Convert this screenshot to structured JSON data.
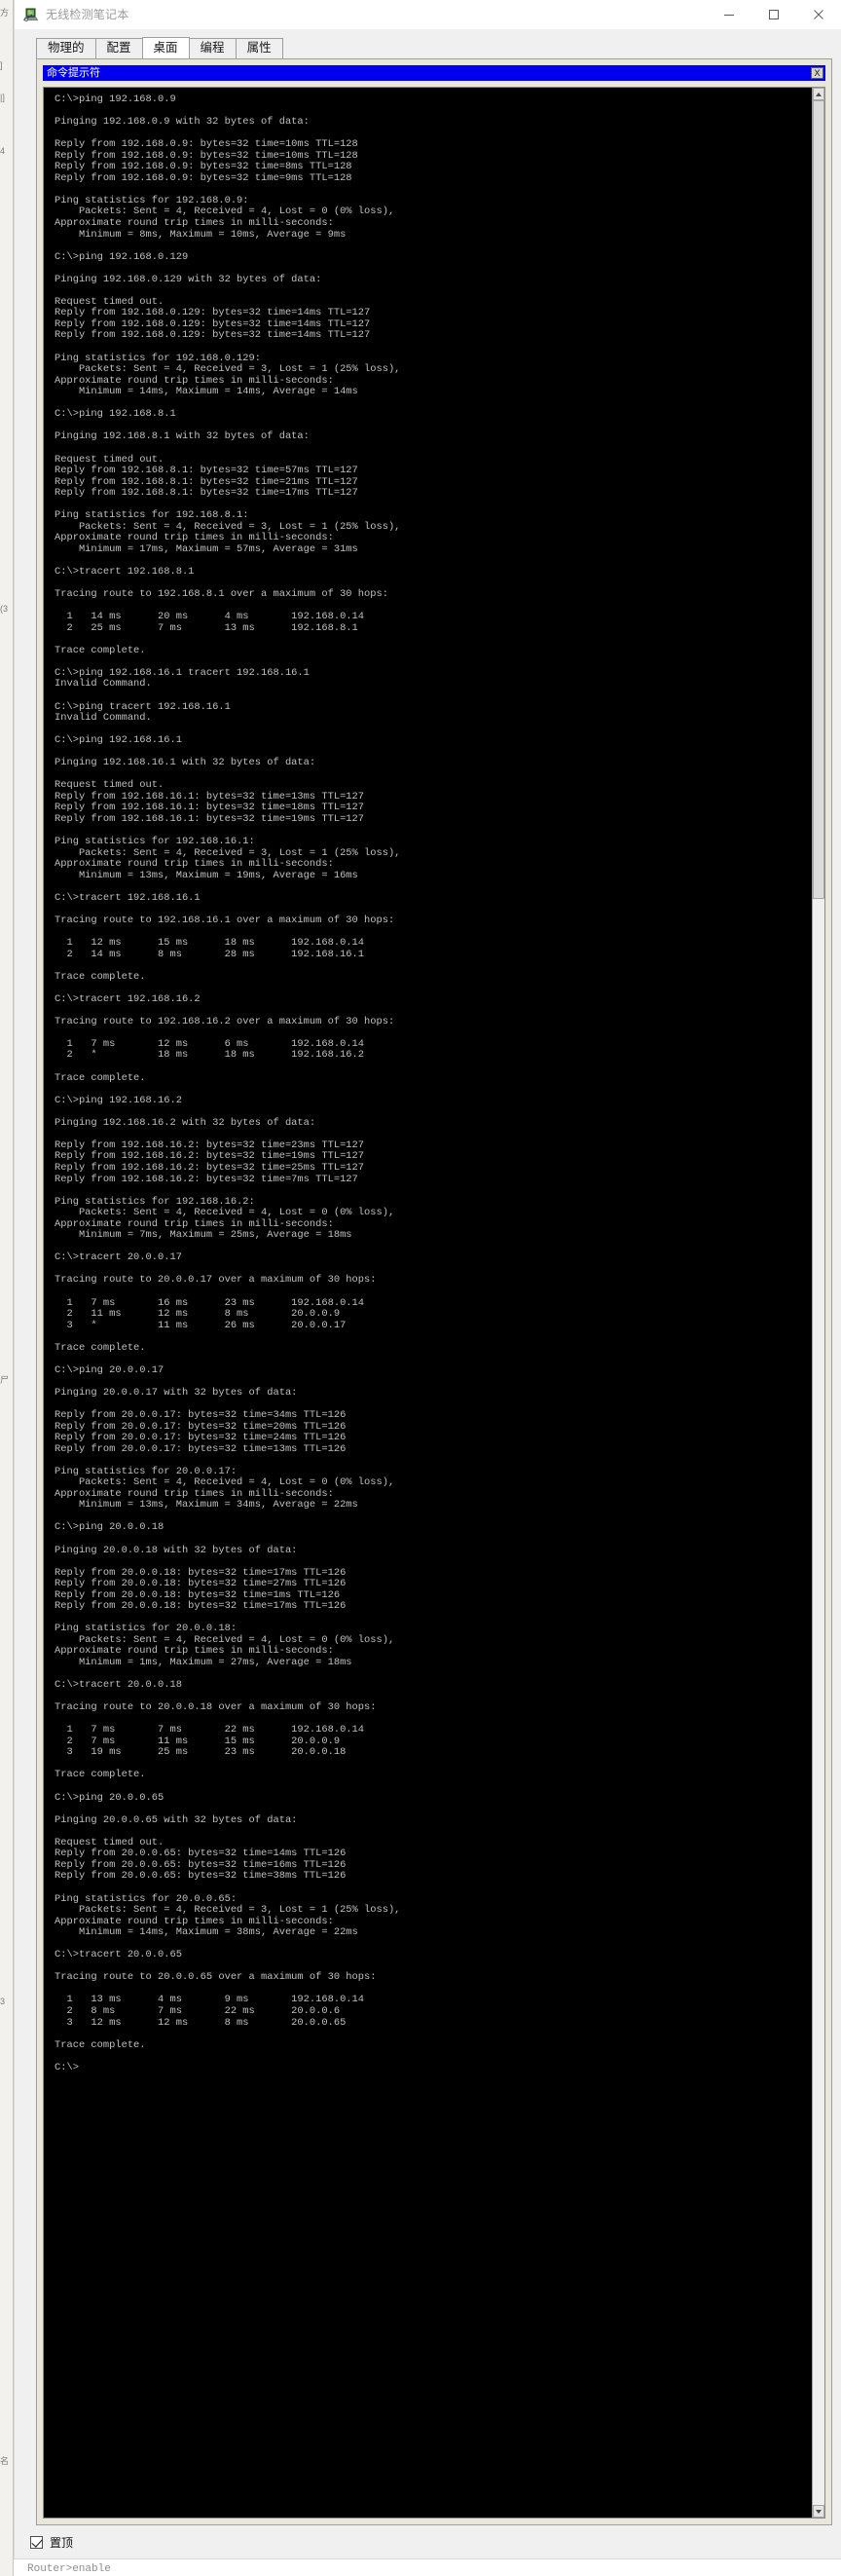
{
  "window": {
    "title": "无线检测笔记本",
    "icon": "laptop-wireless-icon",
    "controls": {
      "minimize": "minimize-icon",
      "maximize": "maximize-icon",
      "close": "close-icon"
    }
  },
  "tabs": [
    {
      "label": "物理的",
      "active": false
    },
    {
      "label": "配置",
      "active": false
    },
    {
      "label": "桌面",
      "active": true
    },
    {
      "label": "编程",
      "active": false
    },
    {
      "label": "属性",
      "active": false
    }
  ],
  "app": {
    "title": "命令提示符",
    "close_label": "X",
    "title_bar_color": "#0000ee",
    "terminal_bg": "#000000",
    "terminal_fg": "#c0c0c0"
  },
  "footer": {
    "always_on_top_label": "置顶",
    "always_on_top_checked": true
  },
  "background": {
    "left_fragments": [
      "方",
      "]",
      "|]",
      "4",
      "(3",
      "尸",
      "3",
      "名"
    ],
    "bottom_text": "Router>enable"
  },
  "terminal": {
    "text": "C:\\>ping 192.168.0.9\n\nPinging 192.168.0.9 with 32 bytes of data:\n\nReply from 192.168.0.9: bytes=32 time=10ms TTL=128\nReply from 192.168.0.9: bytes=32 time=10ms TTL=128\nReply from 192.168.0.9: bytes=32 time=8ms TTL=128\nReply from 192.168.0.9: bytes=32 time=9ms TTL=128\n\nPing statistics for 192.168.0.9:\n    Packets: Sent = 4, Received = 4, Lost = 0 (0% loss),\nApproximate round trip times in milli-seconds:\n    Minimum = 8ms, Maximum = 10ms, Average = 9ms\n\nC:\\>ping 192.168.0.129\n\nPinging 192.168.0.129 with 32 bytes of data:\n\nRequest timed out.\nReply from 192.168.0.129: bytes=32 time=14ms TTL=127\nReply from 192.168.0.129: bytes=32 time=14ms TTL=127\nReply from 192.168.0.129: bytes=32 time=14ms TTL=127\n\nPing statistics for 192.168.0.129:\n    Packets: Sent = 4, Received = 3, Lost = 1 (25% loss),\nApproximate round trip times in milli-seconds:\n    Minimum = 14ms, Maximum = 14ms, Average = 14ms\n\nC:\\>ping 192.168.8.1\n\nPinging 192.168.8.1 with 32 bytes of data:\n\nRequest timed out.\nReply from 192.168.8.1: bytes=32 time=57ms TTL=127\nReply from 192.168.8.1: bytes=32 time=21ms TTL=127\nReply from 192.168.8.1: bytes=32 time=17ms TTL=127\n\nPing statistics for 192.168.8.1:\n    Packets: Sent = 4, Received = 3, Lost = 1 (25% loss),\nApproximate round trip times in milli-seconds:\n    Minimum = 17ms, Maximum = 57ms, Average = 31ms\n\nC:\\>tracert 192.168.8.1\n\nTracing route to 192.168.8.1 over a maximum of 30 hops:\n\n  1   14 ms      20 ms      4 ms       192.168.0.14\n  2   25 ms      7 ms       13 ms      192.168.8.1\n\nTrace complete.\n\nC:\\>ping 192.168.16.1 tracert 192.168.16.1\nInvalid Command.\n\nC:\\>ping tracert 192.168.16.1\nInvalid Command.\n\nC:\\>ping 192.168.16.1\n\nPinging 192.168.16.1 with 32 bytes of data:\n\nRequest timed out.\nReply from 192.168.16.1: bytes=32 time=13ms TTL=127\nReply from 192.168.16.1: bytes=32 time=18ms TTL=127\nReply from 192.168.16.1: bytes=32 time=19ms TTL=127\n\nPing statistics for 192.168.16.1:\n    Packets: Sent = 4, Received = 3, Lost = 1 (25% loss),\nApproximate round trip times in milli-seconds:\n    Minimum = 13ms, Maximum = 19ms, Average = 16ms\n\nC:\\>tracert 192.168.16.1\n\nTracing route to 192.168.16.1 over a maximum of 30 hops:\n\n  1   12 ms      15 ms      18 ms      192.168.0.14\n  2   14 ms      8 ms       28 ms      192.168.16.1\n\nTrace complete.\n\nC:\\>tracert 192.168.16.2\n\nTracing route to 192.168.16.2 over a maximum of 30 hops:\n\n  1   7 ms       12 ms      6 ms       192.168.0.14\n  2   *          18 ms      18 ms      192.168.16.2\n\nTrace complete.\n\nC:\\>ping 192.168.16.2\n\nPinging 192.168.16.2 with 32 bytes of data:\n\nReply from 192.168.16.2: bytes=32 time=23ms TTL=127\nReply from 192.168.16.2: bytes=32 time=19ms TTL=127\nReply from 192.168.16.2: bytes=32 time=25ms TTL=127\nReply from 192.168.16.2: bytes=32 time=7ms TTL=127\n\nPing statistics for 192.168.16.2:\n    Packets: Sent = 4, Received = 4, Lost = 0 (0% loss),\nApproximate round trip times in milli-seconds:\n    Minimum = 7ms, Maximum = 25ms, Average = 18ms\n\nC:\\>tracert 20.0.0.17\n\nTracing route to 20.0.0.17 over a maximum of 30 hops:\n\n  1   7 ms       16 ms      23 ms      192.168.0.14\n  2   11 ms      12 ms      8 ms       20.0.0.9\n  3   *          11 ms      26 ms      20.0.0.17\n\nTrace complete.\n\nC:\\>ping 20.0.0.17\n\nPinging 20.0.0.17 with 32 bytes of data:\n\nReply from 20.0.0.17: bytes=32 time=34ms TTL=126\nReply from 20.0.0.17: bytes=32 time=20ms TTL=126\nReply from 20.0.0.17: bytes=32 time=24ms TTL=126\nReply from 20.0.0.17: bytes=32 time=13ms TTL=126\n\nPing statistics for 20.0.0.17:\n    Packets: Sent = 4, Received = 4, Lost = 0 (0% loss),\nApproximate round trip times in milli-seconds:\n    Minimum = 13ms, Maximum = 34ms, Average = 22ms\n\nC:\\>ping 20.0.0.18\n\nPinging 20.0.0.18 with 32 bytes of data:\n\nReply from 20.0.0.18: bytes=32 time=17ms TTL=126\nReply from 20.0.0.18: bytes=32 time=27ms TTL=126\nReply from 20.0.0.18: bytes=32 time=1ms TTL=126\nReply from 20.0.0.18: bytes=32 time=17ms TTL=126\n\nPing statistics for 20.0.0.18:\n    Packets: Sent = 4, Received = 4, Lost = 0 (0% loss),\nApproximate round trip times in milli-seconds:\n    Minimum = 1ms, Maximum = 27ms, Average = 18ms\n\nC:\\>tracert 20.0.0.18\n\nTracing route to 20.0.0.18 over a maximum of 30 hops:\n\n  1   7 ms       7 ms       22 ms      192.168.0.14\n  2   7 ms       11 ms      15 ms      20.0.0.9\n  3   19 ms      25 ms      23 ms      20.0.0.18\n\nTrace complete.\n\nC:\\>ping 20.0.0.65\n\nPinging 20.0.0.65 with 32 bytes of data:\n\nRequest timed out.\nReply from 20.0.0.65: bytes=32 time=14ms TTL=126\nReply from 20.0.0.65: bytes=32 time=16ms TTL=126\nReply from 20.0.0.65: bytes=32 time=38ms TTL=126\n\nPing statistics for 20.0.0.65:\n    Packets: Sent = 4, Received = 3, Lost = 1 (25% loss),\nApproximate round trip times in milli-seconds:\n    Minimum = 14ms, Maximum = 38ms, Average = 22ms\n\nC:\\>tracert 20.0.0.65\n\nTracing route to 20.0.0.65 over a maximum of 30 hops:\n\n  1   13 ms      4 ms       9 ms       192.168.0.14\n  2   8 ms       7 ms       22 ms      20.0.0.6\n  3   12 ms      12 ms      8 ms       20.0.0.65\n\nTrace complete.\n\nC:\\>"
  }
}
